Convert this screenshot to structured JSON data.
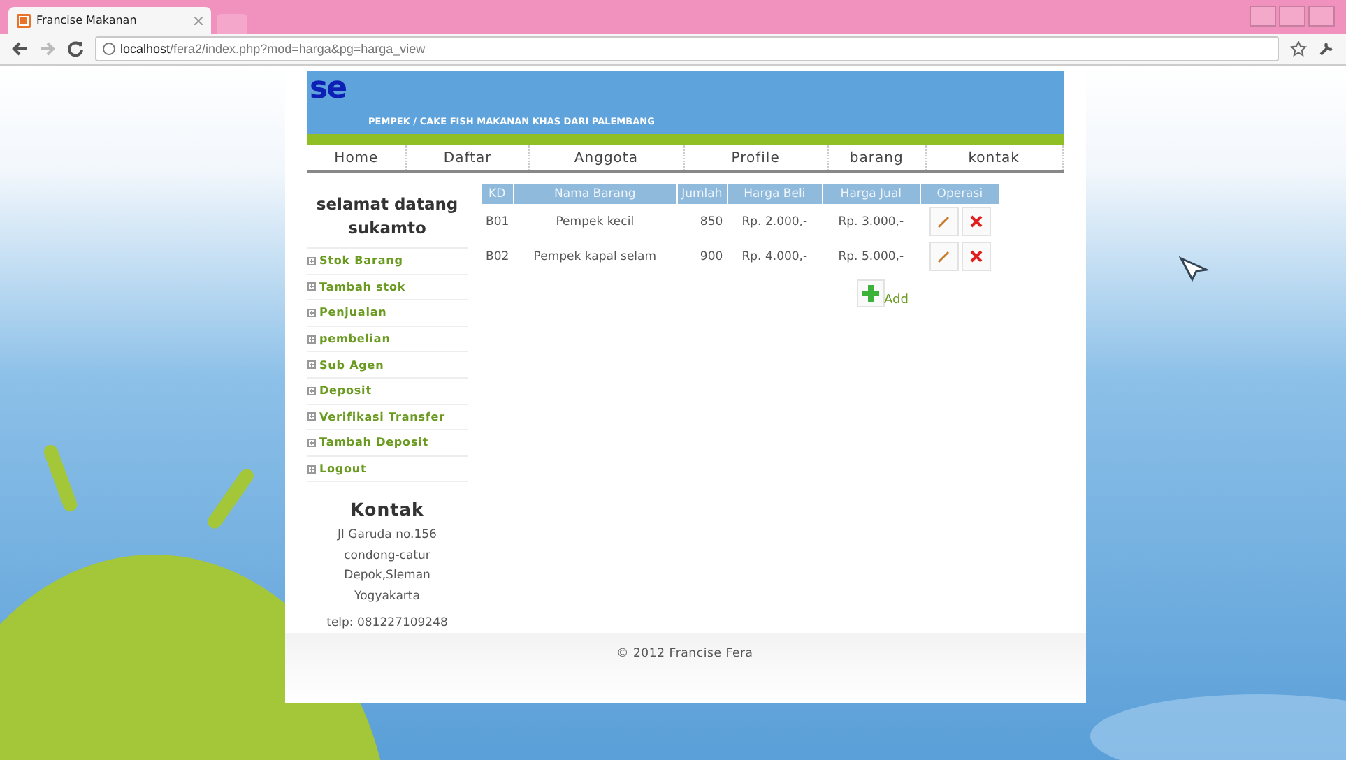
{
  "browser": {
    "tab_title": "Francise Makanan",
    "address_host": "localhost",
    "address_path": "/fera2/index.php?mod=harga&pg=harga_view"
  },
  "header": {
    "logo": "se",
    "tagline": "PEMPEK / CAKE FISH MAKANAN KHAS DARI PALEMBANG"
  },
  "nav": [
    {
      "label": "Home"
    },
    {
      "label": "Daftar"
    },
    {
      "label": "Anggota"
    },
    {
      "label": "Profile"
    },
    {
      "label": "barang"
    },
    {
      "label": "kontak"
    }
  ],
  "sidebar": {
    "greeting": [
      "selamat datang",
      "sukamto"
    ],
    "menu": [
      {
        "label": "Stok Barang"
      },
      {
        "label": "Tambah stok"
      },
      {
        "label": "Penjualan"
      },
      {
        "label": "pembelian"
      },
      {
        "label": "Sub Agen"
      },
      {
        "label": "Deposit"
      },
      {
        "label": "Verifikasi Transfer"
      },
      {
        "label": "Tambah Deposit"
      },
      {
        "label": "Logout"
      }
    ],
    "contact": {
      "title": "Kontak",
      "address": [
        "Jl Garuda no.156",
        "condong-catur",
        "Depok,Sleman",
        "Yogyakarta"
      ],
      "phone": "telp: 081227109248"
    }
  },
  "table": {
    "columns": [
      "KD",
      "Nama Barang",
      "Jumlah",
      "Harga Beli",
      "Harga Jual",
      "Operasi"
    ],
    "rows": [
      {
        "kd": "B01",
        "nama": "Pempek kecil",
        "jumlah": "850",
        "beli": "Rp. 2.000,-",
        "jual": "Rp. 3.000,-"
      },
      {
        "kd": "B02",
        "nama": "Pempek kapal selam",
        "jumlah": "900",
        "beli": "Rp. 4.000,-",
        "jual": "Rp. 5.000,-"
      }
    ],
    "add_label": "Add"
  },
  "footer": "© 2012 Francise Fera"
}
